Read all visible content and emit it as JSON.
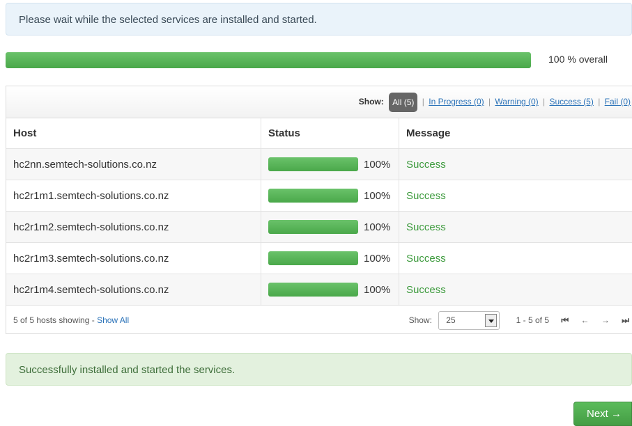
{
  "info_message": "Please wait while the selected services are installed and started.",
  "overall": {
    "percent_label": "100",
    "suffix": "% overall",
    "progress": 1.0
  },
  "filter": {
    "label": "Show:",
    "active": "All (5)",
    "links": [
      "In Progress (0)",
      "Warning (0)",
      "Success (5)",
      "Fail (0)"
    ]
  },
  "table": {
    "headers": [
      "Host",
      "Status",
      "Message"
    ],
    "rows": [
      {
        "host": "hc2nn.semtech-solutions.co.nz",
        "percent": "100%",
        "progress": 1.0,
        "message": "Success"
      },
      {
        "host": "hc2r1m1.semtech-solutions.co.nz",
        "percent": "100%",
        "progress": 1.0,
        "message": "Success"
      },
      {
        "host": "hc2r1m2.semtech-solutions.co.nz",
        "percent": "100%",
        "progress": 1.0,
        "message": "Success"
      },
      {
        "host": "hc2r1m3.semtech-solutions.co.nz",
        "percent": "100%",
        "progress": 1.0,
        "message": "Success"
      },
      {
        "host": "hc2r1m4.semtech-solutions.co.nz",
        "percent": "100%",
        "progress": 1.0,
        "message": "Success"
      }
    ]
  },
  "footer": {
    "hosts_showing": "5 of 5 hosts showing - ",
    "show_all": "Show All",
    "show_label": "Show:",
    "page_size": "25",
    "range": "1 - 5 of 5"
  },
  "success_message": "Successfully installed and started the services.",
  "next_button": "Next →",
  "colors": {
    "progress_green": "#4aa84a",
    "success_text": "#3e9b3e",
    "link_blue": "#2a72b8"
  }
}
